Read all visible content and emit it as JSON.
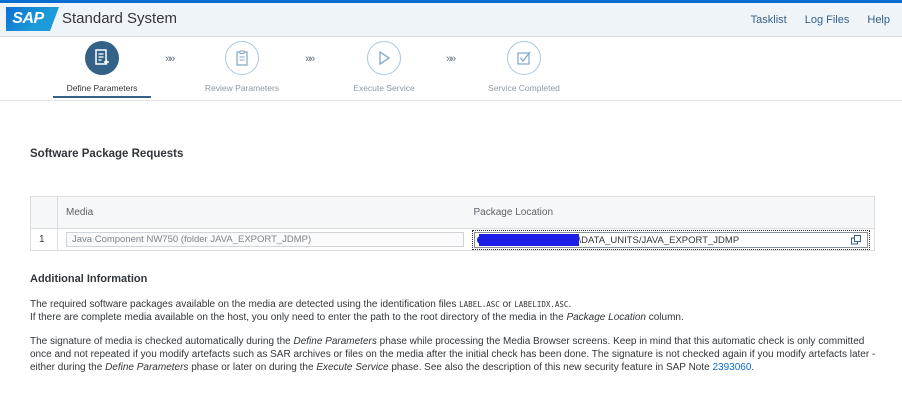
{
  "header": {
    "logo_text": "SAP",
    "title": "Standard System",
    "links": [
      "Tasklist",
      "Log Files",
      "Help"
    ]
  },
  "steps": [
    {
      "label": "Define Parameters",
      "state": "active",
      "icon": "document-edit-icon"
    },
    {
      "label": "Review Parameters",
      "state": "inactive",
      "icon": "clipboard-icon"
    },
    {
      "label": "Execute Service",
      "state": "inactive",
      "icon": "play-icon"
    },
    {
      "label": "Service Completed",
      "state": "inactive",
      "icon": "checkbox-icon"
    }
  ],
  "chevron": "»»",
  "section_title": "Software Package Requests",
  "table": {
    "headers": [
      "",
      "Media",
      "Package Location"
    ],
    "rows": [
      {
        "num": "1",
        "media": "Java Component NW750 (folder JAVA_EXPORT_JDMP)",
        "location": "\\DATA_UNITS/JAVA_EXPORT_JDMP"
      }
    ]
  },
  "additional": {
    "title": "Additional Information",
    "p1_a": "The required software packages available on the media are detected using the identification files ",
    "p1_code1": "LABEL.ASC",
    "p1_or": " or ",
    "p1_code2": "LABELIDX.ASC",
    "p1_end": ".",
    "p1_b": "If there are complete media available on the host, you only need to enter the path to the root directory of the media in the ",
    "p1_b_it": "Package Location",
    "p1_b_end": " column.",
    "p2_a": "The signature of media is checked automatically during the ",
    "p2_it1": "Define Parameters",
    "p2_b": " phase while processing the Media Browser screens. Keep in mind that this automatic check is only committed once and not repeated if you modify artefacts such as SAR archives or files on the media after the initial check has been done. The signature is not checked again if you modify artefacts later - either during the ",
    "p2_it2": "Define Parameters",
    "p2_c": " phase or later on during the ",
    "p2_it3": "Execute Service",
    "p2_d": " phase. See also the description of this new security feature in SAP Note ",
    "p2_link": "2393060",
    "p2_end": "."
  },
  "colors": {
    "accent": "#346187",
    "link": "#0a6ed1",
    "header_bg": "#eff4f9"
  }
}
